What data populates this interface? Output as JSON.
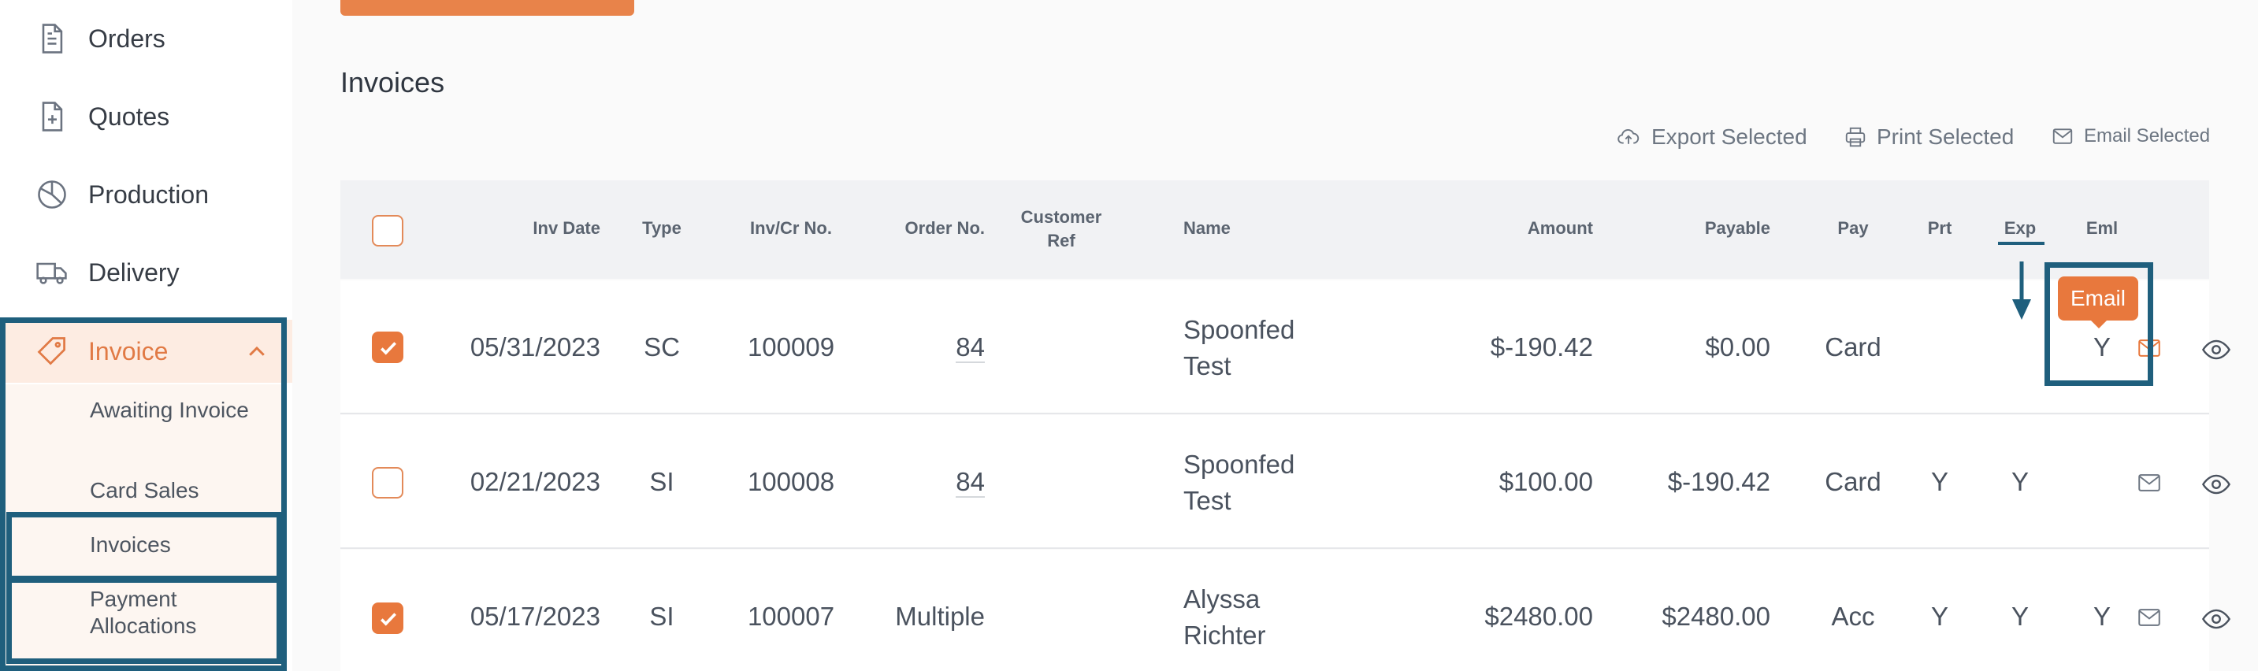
{
  "sidebar": {
    "items": [
      {
        "label": "Orders",
        "icon": "document-icon"
      },
      {
        "label": "Quotes",
        "icon": "document-plus-icon"
      },
      {
        "label": "Production",
        "icon": "pie-chart-icon"
      },
      {
        "label": "Delivery",
        "icon": "truck-icon"
      },
      {
        "label": "Invoice",
        "icon": "tag-icon",
        "active": true
      }
    ],
    "invoice_submenu": [
      {
        "label": "Awaiting Invoice"
      },
      {
        "label": "Card Sales"
      },
      {
        "label": "Invoices",
        "active": true
      },
      {
        "label": "Payment Allocations"
      }
    ]
  },
  "main": {
    "title": "Invoices",
    "toolbar": {
      "export": "Export Selected",
      "print": "Print Selected",
      "email": "Email Selected"
    },
    "columns": {
      "inv_date": "Inv Date",
      "type": "Type",
      "inv_no": "Inv/Cr No.",
      "order_no": "Order No.",
      "customer_ref_1": "Customer",
      "customer_ref_2": "Ref",
      "name": "Name",
      "amount": "Amount",
      "payable": "Payable",
      "pay": "Pay",
      "prt": "Prt",
      "exp": "Exp",
      "eml": "Eml"
    },
    "rows": [
      {
        "checked": true,
        "date": "05/31/2023",
        "type": "SC",
        "inv_no": "100009",
        "order_no": "84",
        "name_1": "Spoonfed",
        "name_2": "Test",
        "amount": "$-190.42",
        "payable": "$0.00",
        "pay": "Card",
        "prt": "",
        "exp": "",
        "eml": "Y"
      },
      {
        "checked": false,
        "date": "02/21/2023",
        "type": "SI",
        "inv_no": "100008",
        "order_no": "84",
        "name_1": "Spoonfed",
        "name_2": "Test",
        "amount": "$100.00",
        "payable": "$-190.42",
        "pay": "Card",
        "prt": "Y",
        "exp": "Y",
        "eml": ""
      },
      {
        "checked": true,
        "date": "05/17/2023",
        "type": "SI",
        "inv_no": "100007",
        "order_no": "Multiple",
        "name_1": "Alyssa",
        "name_2": "Richter",
        "amount": "$2480.00",
        "payable": "$2480.00",
        "pay": "Acc",
        "prt": "Y",
        "exp": "Y",
        "eml": "Y"
      }
    ],
    "tooltip": "Email"
  },
  "colors": {
    "accent": "#e8783d",
    "highlight": "#1f5f7d"
  }
}
